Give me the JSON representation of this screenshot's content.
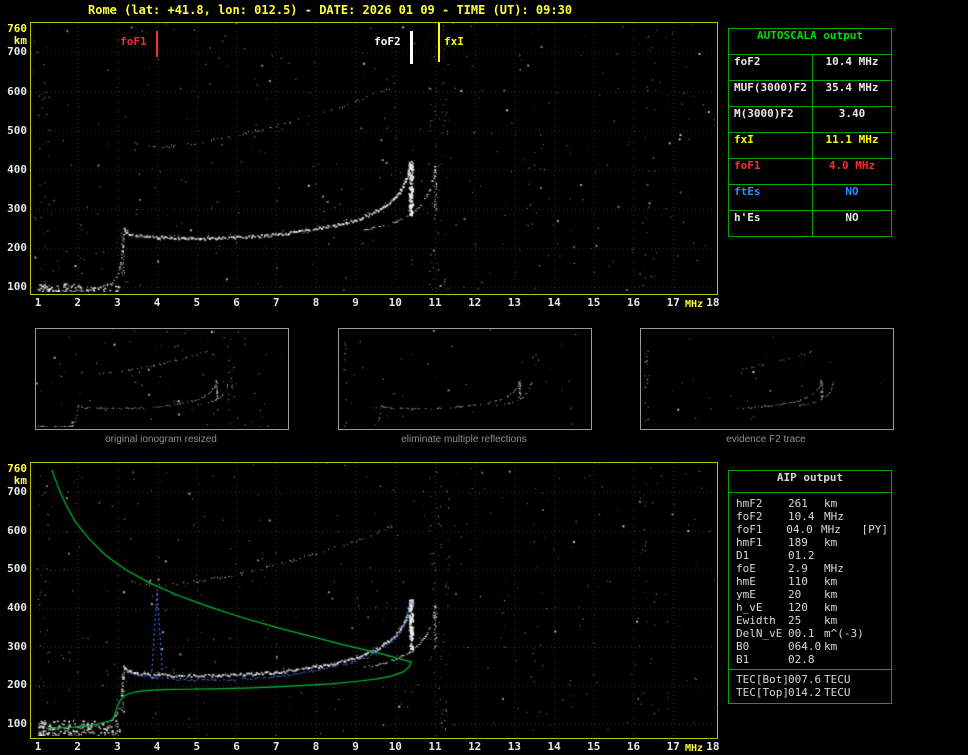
{
  "header": {
    "title": "Rome (lat: +41.8, lon: 012.5) - DATE: 2026 01 09 - TIME (UT): 09:30"
  },
  "axes": {
    "x_ticks": [
      "1",
      "2",
      "3",
      "4",
      "5",
      "6",
      "7",
      "8",
      "9",
      "10",
      "11",
      "12",
      "13",
      "14",
      "15",
      "16",
      "17",
      "18"
    ],
    "x_unit": "MHz",
    "y_ticks": [
      "760",
      "700",
      "600",
      "500",
      "400",
      "300",
      "200",
      "100"
    ],
    "y_unit": "km"
  },
  "markers": [
    {
      "label": "foF1",
      "freq_mhz": 4.0,
      "color": "#ff2a2a"
    },
    {
      "label": "foF2",
      "freq_mhz": 10.4,
      "color": "#ffffff"
    },
    {
      "label": "fxI",
      "freq_mhz": 11.1,
      "color": "#ffff00"
    }
  ],
  "autoscala": {
    "title": "AUTOSCALA output",
    "rows": [
      {
        "label": "foF2",
        "value": "10.4 MHz",
        "color": "#e8e8e8"
      },
      {
        "label": "MUF(3000)F2",
        "value": "35.4 MHz",
        "color": "#e8e8e8"
      },
      {
        "label": "M(3000)F2",
        "value": "3.40",
        "color": "#e8e8e8"
      },
      {
        "label": "fxI",
        "value": "11.1 MHz",
        "color": "#ffff00"
      },
      {
        "label": "foF1",
        "value": "4.0 MHz",
        "color": "#ff2a2a"
      },
      {
        "label": "ftEs",
        "value": "NO",
        "color": "#2e8bff"
      },
      {
        "label": "h'Es",
        "value": "NO",
        "color": "#e8e8e8"
      }
    ]
  },
  "panels": [
    {
      "caption": "original ionogram resized"
    },
    {
      "caption": "eliminate multiple reflections"
    },
    {
      "caption": "evidence F2 trace"
    }
  ],
  "aip": {
    "title": "AIP output",
    "rows": [
      {
        "label": "hmF2",
        "value": "261",
        "unit": "km",
        "extra": ""
      },
      {
        "label": "foF2",
        "value": "10.4",
        "unit": "MHz",
        "extra": ""
      },
      {
        "label": "foF1",
        "value": "04.0",
        "unit": "MHz",
        "extra": "[PY]"
      },
      {
        "label": "hmF1",
        "value": "189",
        "unit": "km",
        "extra": ""
      },
      {
        "label": "D1",
        "value": "01.2",
        "unit": "",
        "extra": ""
      },
      {
        "label": "foE",
        "value": "2.9",
        "unit": "MHz",
        "extra": ""
      },
      {
        "label": "hmE",
        "value": "110",
        "unit": "km",
        "extra": ""
      },
      {
        "label": "ymE",
        "value": "20",
        "unit": "km",
        "extra": ""
      },
      {
        "label": "h_vE",
        "value": "120",
        "unit": "km",
        "extra": ""
      },
      {
        "label": "Ewidth",
        "value": "25",
        "unit": "km",
        "extra": ""
      },
      {
        "label": "DelN_vE",
        "value": "00.1",
        "unit": "m^(-3)",
        "extra": ""
      },
      {
        "label": "B0",
        "value": "064.0",
        "unit": "km",
        "extra": ""
      },
      {
        "label": "B1",
        "value": "02.8",
        "unit": "",
        "extra": ""
      }
    ],
    "tec_rows": [
      {
        "label": "TEC[Bot]",
        "value": "007.6",
        "unit": "TECU"
      },
      {
        "label": "TEC[Top]",
        "value": "014.2",
        "unit": "TECU"
      }
    ]
  },
  "chart_data": {
    "type": "scatter",
    "title": "Ionogram with autoscaled characteristics and inverted electron density profile",
    "x_axis": {
      "label": "MHz",
      "min": 1,
      "max": 18
    },
    "y_axis": {
      "label": "km",
      "min": 100,
      "max": 760
    },
    "scaled_values": {
      "foF2_MHz": 10.4,
      "MUF3000F2_MHz": 35.4,
      "M3000F2": 3.4,
      "fxI_MHz": 11.1,
      "foF1_MHz": 4.0,
      "ftEs": "NO",
      "hEs": "NO"
    },
    "traces": {
      "f_ordinary": [
        [
          3.15,
          252
        ],
        [
          3.2,
          242
        ],
        [
          3.35,
          236
        ],
        [
          3.6,
          232
        ],
        [
          4,
          229
        ],
        [
          4.5,
          227
        ],
        [
          5,
          226
        ],
        [
          5.5,
          227
        ],
        [
          6,
          229
        ],
        [
          6.5,
          232
        ],
        [
          7,
          236
        ],
        [
          7.5,
          242
        ],
        [
          8,
          250
        ],
        [
          8.5,
          260
        ],
        [
          9,
          273
        ],
        [
          9.3,
          285
        ],
        [
          9.6,
          300
        ],
        [
          9.9,
          322
        ],
        [
          10.1,
          345
        ],
        [
          10.25,
          372
        ],
        [
          10.33,
          400
        ],
        [
          10.38,
          425
        ]
      ],
      "f_extraordinary": [
        [
          9.2,
          248
        ],
        [
          9.5,
          254
        ],
        [
          9.8,
          262
        ],
        [
          10.1,
          274
        ],
        [
          10.4,
          290
        ],
        [
          10.6,
          308
        ],
        [
          10.75,
          330
        ],
        [
          10.87,
          356
        ],
        [
          10.95,
          385
        ],
        [
          11.0,
          412
        ]
      ],
      "multiple_hop": [
        [
          3.35,
          470
        ],
        [
          3.6,
          464
        ],
        [
          3.9,
          460
        ],
        [
          4.3,
          461
        ],
        [
          4.7,
          465
        ],
        [
          5.1,
          471
        ],
        [
          5.5,
          479
        ],
        [
          5.9,
          487
        ],
        [
          6.2,
          494
        ],
        [
          6.6,
          503
        ],
        [
          7,
          513
        ],
        [
          7.4,
          524
        ],
        [
          7.8,
          536
        ],
        [
          8.2,
          549
        ],
        [
          8.6,
          562
        ],
        [
          9,
          576
        ],
        [
          9.4,
          592
        ],
        [
          9.7,
          605
        ],
        [
          9.95,
          615
        ]
      ],
      "e_layer": [
        [
          1,
          96
        ],
        [
          1.4,
          91
        ],
        [
          1.8,
          90
        ],
        [
          2.2,
          93
        ],
        [
          2.5,
          98
        ],
        [
          2.7,
          104
        ],
        [
          2.85,
          112
        ],
        [
          2.95,
          124
        ],
        [
          3.02,
          142
        ],
        [
          3.08,
          168
        ],
        [
          3.12,
          200
        ],
        [
          3.15,
          240
        ]
      ]
    },
    "profile": {
      "topside": [
        [
          1.35,
          758
        ],
        [
          1.5,
          715
        ],
        [
          1.7,
          668
        ],
        [
          1.95,
          622
        ],
        [
          2.3,
          578
        ],
        [
          2.7,
          537
        ],
        [
          3.2,
          500
        ],
        [
          3.8,
          466
        ],
        [
          4.5,
          434
        ],
        [
          5.3,
          404
        ],
        [
          6.1,
          377
        ],
        [
          7,
          350
        ],
        [
          7.9,
          326
        ],
        [
          8.7,
          305
        ],
        [
          9.4,
          288
        ],
        [
          9.9,
          275
        ],
        [
          10.2,
          266
        ],
        [
          10.4,
          261
        ]
      ],
      "bottomside": [
        [
          10.4,
          261
        ],
        [
          10.35,
          248
        ],
        [
          10.2,
          235
        ],
        [
          9.9,
          224
        ],
        [
          9.5,
          216
        ],
        [
          9,
          210
        ],
        [
          8.4,
          204
        ],
        [
          7.7,
          200
        ],
        [
          7,
          196
        ],
        [
          6.2,
          193
        ],
        [
          5.4,
          191
        ],
        [
          4.7,
          190
        ],
        [
          4.15,
          189
        ],
        [
          3.8,
          187
        ],
        [
          3.5,
          184
        ],
        [
          3.3,
          179
        ],
        [
          3.15,
          171
        ],
        [
          3.05,
          158
        ],
        [
          2.98,
          140
        ],
        [
          2.93,
          122
        ],
        [
          2.9,
          112
        ],
        [
          2.75,
          106
        ],
        [
          2.5,
          100
        ],
        [
          2.2,
          95
        ],
        [
          1.9,
          92
        ],
        [
          1.5,
          90
        ],
        [
          1.2,
          89
        ]
      ]
    },
    "restored_trace": [
      [
        3.3,
        232
      ],
      [
        3.6,
        226
      ],
      [
        4,
        221
      ],
      [
        4.4,
        217
      ],
      [
        4.9,
        215
      ],
      [
        5.4,
        215
      ],
      [
        5.9,
        216
      ],
      [
        6.4,
        219
      ],
      [
        6.9,
        224
      ],
      [
        7.4,
        230
      ],
      [
        7.9,
        238
      ],
      [
        8.4,
        248
      ],
      [
        8.9,
        261
      ],
      [
        9.3,
        275
      ],
      [
        9.6,
        292
      ],
      [
        9.9,
        315
      ],
      [
        10.1,
        340
      ],
      [
        10.25,
        370
      ],
      [
        10.33,
        400
      ],
      [
        10.37,
        430
      ]
    ],
    "f1_spike_freq": 4.0
  }
}
